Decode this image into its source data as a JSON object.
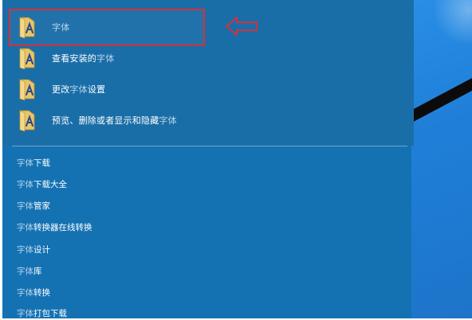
{
  "results": [
    {
      "prefix": "",
      "highlight": "字体",
      "suffix": "",
      "icon": "folder-font-icon"
    },
    {
      "prefix": "查看安装的",
      "highlight": "字体",
      "suffix": "",
      "icon": "folder-font-icon"
    },
    {
      "prefix": "更改",
      "highlight": "字体",
      "suffix": "设置",
      "icon": "folder-font-icon"
    },
    {
      "prefix": "预览、删除或者显示和隐藏",
      "highlight": "字体",
      "suffix": "",
      "icon": "folder-font-icon"
    }
  ],
  "suggestions": [
    {
      "highlight": "字体",
      "rest": "下载"
    },
    {
      "highlight": "字体",
      "rest": "下载大全"
    },
    {
      "highlight": "字体",
      "rest": "管家"
    },
    {
      "highlight": "字体",
      "rest": "转换器在线转换"
    },
    {
      "highlight": "字体",
      "rest": "设计"
    },
    {
      "highlight": "字体",
      "rest": "库"
    },
    {
      "highlight": "字体",
      "rest": "转换"
    },
    {
      "highlight": "字体",
      "rest": "打包下载"
    }
  ],
  "colors": {
    "panel": "#1472b3",
    "highlight_box": "#d6303b",
    "arrow": "#d6303b",
    "matched_text": "#b9d4ec"
  }
}
